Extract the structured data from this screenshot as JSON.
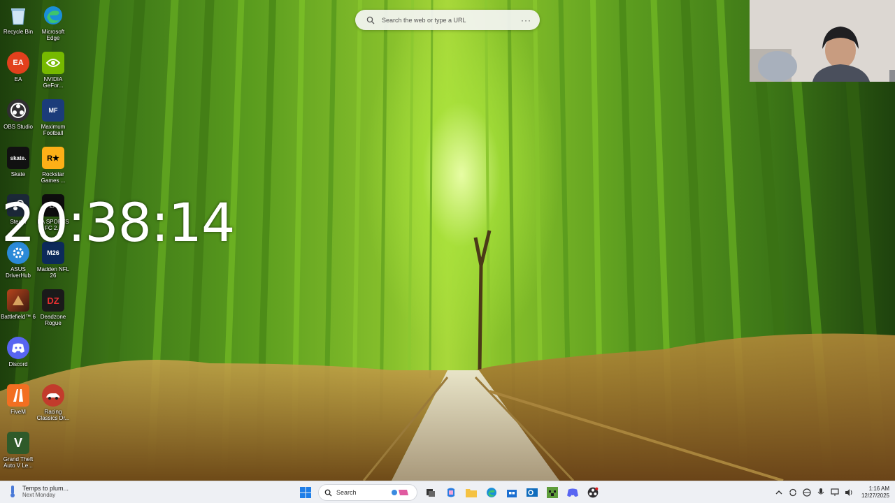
{
  "browser_search": {
    "placeholder": "Search the web or type a URL",
    "more_icon": "more-horizontal-icon"
  },
  "clock_overlay": {
    "time": "20:38:14"
  },
  "desktop_icons": [
    {
      "label": "Recycle Bin",
      "icon": "recycle-bin-icon"
    },
    {
      "label": "Microsoft Edge",
      "icon": "edge-icon"
    },
    {
      "label": "EA",
      "icon": "ea-icon",
      "color": "#e2401d"
    },
    {
      "label": "NVIDIA GeFor...",
      "icon": "nvidia-icon",
      "color": "#76b900"
    },
    {
      "label": "OBS Studio",
      "icon": "obs-icon",
      "color": "#302e31"
    },
    {
      "label": "Maximum Football",
      "icon": "maximum-football-icon",
      "color": "#1b3c7a"
    },
    {
      "label": "Skate",
      "icon": "skate-icon",
      "color": "#111111"
    },
    {
      "label": "Rockstar Games ...",
      "icon": "rockstar-icon",
      "color": "#fcaf17"
    },
    {
      "label": "Steam",
      "icon": "steam-icon",
      "color": "#1b2838"
    },
    {
      "label": "EA SPORTS FC 2...",
      "icon": "ea-sports-fc-icon",
      "color": "#0d0d0d"
    },
    {
      "label": "ASUS DriverHub",
      "icon": "asus-driverhub-icon",
      "color": "#2a8ad8"
    },
    {
      "label": "Madden NFL 26",
      "icon": "madden-icon",
      "color": "#0c2a5a"
    },
    {
      "label": "Battlefield™ 6",
      "icon": "battlefield-icon",
      "color": "#7a2a14"
    },
    {
      "label": "Deadzone Rogue",
      "icon": "deadzone-icon",
      "color": "#1a1a1a"
    },
    {
      "label": "Discord",
      "icon": "discord-icon",
      "color": "#5865f2"
    },
    {
      "label": "FiveM",
      "icon": "fivem-icon",
      "color": "#f26f21"
    },
    {
      "label": "Racing Classics Dr...",
      "icon": "racing-classics-icon",
      "color": "#c23b2c"
    },
    {
      "label": "Grand Theft Auto V Le...",
      "icon": "gta-icon",
      "color": "#2f5a2a"
    }
  ],
  "icon_glyphs": {
    "ea": "EA",
    "skate": "skate.",
    "rockstar": "R★",
    "madden": "M26",
    "deadzone": "DZ",
    "gta": "V",
    "maxfb": "MF"
  },
  "taskbar": {
    "weather_line1": "Temps to plum...",
    "weather_line2": "Next Monday",
    "search_label": "Search",
    "apps": [
      "start-icon",
      "task-view-icon",
      "copilot-icon",
      "file-explorer-icon",
      "edge-icon",
      "microsoft-store-icon",
      "outlook-icon",
      "minecraft-icon",
      "discord-icon",
      "obs-icon"
    ],
    "tray": {
      "time": "1:16 AM",
      "date": "12/27/2025"
    }
  }
}
